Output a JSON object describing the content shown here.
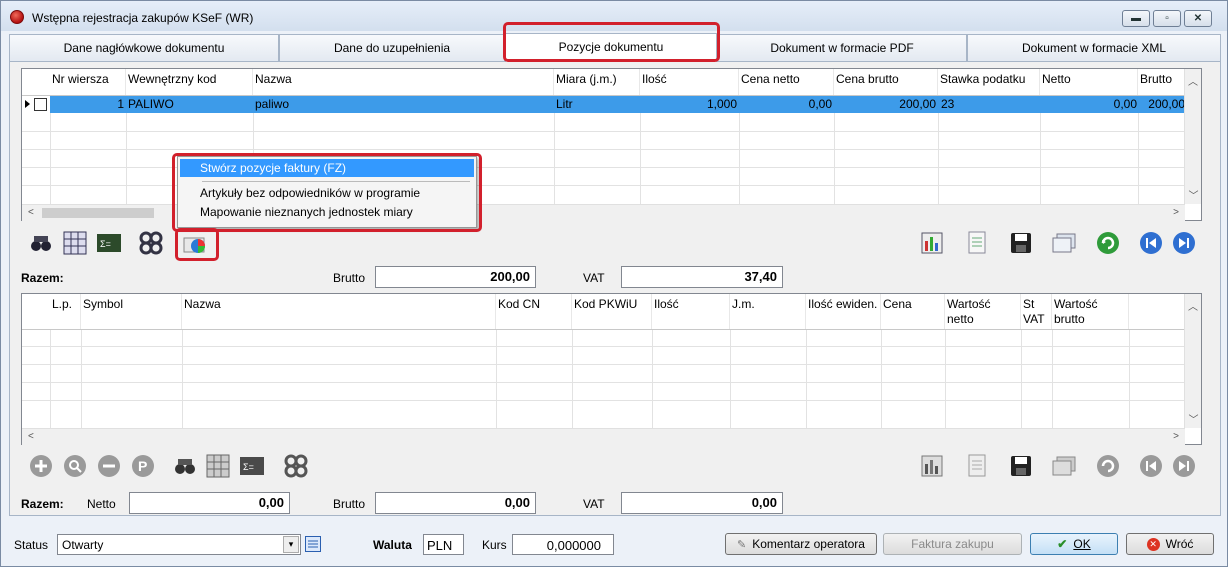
{
  "window": {
    "title": "Wstępna rejestracja zakupów KSeF (WR)",
    "min": "▬",
    "max": "▫",
    "close": "✕"
  },
  "tabs": [
    {
      "label": "Dane nagłówkowe dokumentu"
    },
    {
      "label": "Dane do uzupełnienia"
    },
    {
      "label": "Pozycje dokumentu"
    },
    {
      "label": "Dokument w formacie PDF"
    },
    {
      "label": "Dokument w formacie XML"
    }
  ],
  "grid1": {
    "columns": [
      "Nr wiersza",
      "Wewnętrzny kod",
      "Nazwa",
      "Miara (j.m.)",
      "Ilość",
      "Cena netto",
      "Cena brutto",
      "Stawka podatku",
      "Netto",
      "Brutto"
    ],
    "rows": [
      {
        "nr": "1",
        "kod": "PALIWO",
        "nazwa": "paliwo",
        "miara": "Litr",
        "ilosc": "1,000",
        "cena_netto": "0,00",
        "cena_brutto": "200,00",
        "stawka": "23",
        "netto": "0,00",
        "brutto": "200,00"
      }
    ]
  },
  "context_menu": {
    "items": [
      "Stwórz pozycje faktury (FZ)",
      "Artykuły bez odpowiedników w programie",
      "Mapowanie nieznanych jednostek miary"
    ]
  },
  "summary1": {
    "label": "Razem:",
    "brutto_label": "Brutto",
    "brutto": "200,00",
    "vat_label": "VAT",
    "vat": "37,40"
  },
  "grid2": {
    "columns": [
      "L.p.",
      "Symbol",
      "Nazwa",
      "Kod CN",
      "Kod PKWiU",
      "Ilość",
      "J.m.",
      "Ilość ewiden.",
      "Cena",
      "Wartość netto",
      "St VAT",
      "Wartość brutto"
    ]
  },
  "summary2": {
    "label": "Razem:",
    "netto_label": "Netto",
    "netto": "0,00",
    "brutto_label": "Brutto",
    "brutto": "0,00",
    "vat_label": "VAT",
    "vat": "0,00"
  },
  "footer": {
    "status_label": "Status",
    "status_value": "Otwarty",
    "waluta_label": "Waluta",
    "waluta": "PLN",
    "kurs_label": "Kurs",
    "kurs": "0,000000",
    "komentarz": "Komentarz operatora",
    "faktura": "Faktura zakupu",
    "ok": "OK",
    "wroc": "Wróć"
  },
  "colors": {
    "highlight": "#d2202c",
    "selection": "#3399ff"
  }
}
